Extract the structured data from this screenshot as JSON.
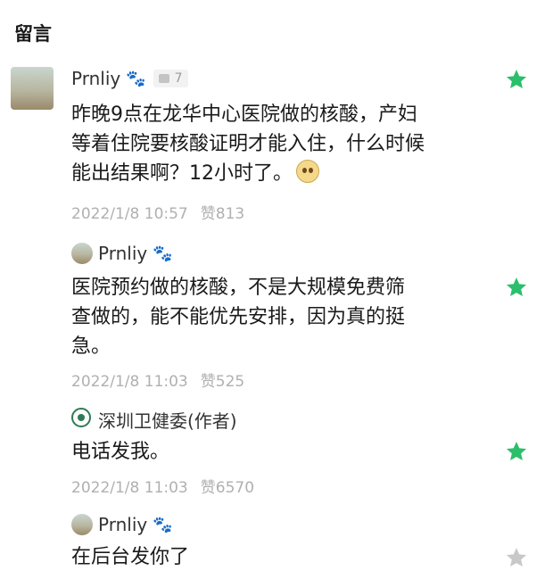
{
  "section": {
    "title": "留言"
  },
  "comments": [
    {
      "user": "Prnliy",
      "paw": "🐾",
      "reply_count": "7",
      "text_lines": [
        "昨晚9点在龙华中心医院做的核酸，产妇",
        "等着住院要核酸证明才能入住，什么时候",
        "能出结果啊？12小时了。"
      ],
      "time": "2022/1/8 10:57",
      "likes": "赞813",
      "starred": true
    },
    {
      "user": "Prnliy",
      "paw": "🐾",
      "text_lines": [
        "医院预约做的核酸，不是大规模免费筛",
        "查做的，能不能优先安排，因为真的挺",
        "急。"
      ],
      "time": "2022/1/8 11:03",
      "likes": "赞525",
      "starred": true
    },
    {
      "user": "深圳卫健委(作者)",
      "text_lines": [
        "电话发我。"
      ],
      "time": "2022/1/8 11:03",
      "likes": "赞6570",
      "starred": true
    },
    {
      "user": "Prnliy",
      "paw": "🐾",
      "text_lines": [
        "在后台发你了"
      ],
      "starred": false
    }
  ],
  "colors": {
    "star_active": "#2bbf6b",
    "star_inactive": "#c8c8c8"
  }
}
